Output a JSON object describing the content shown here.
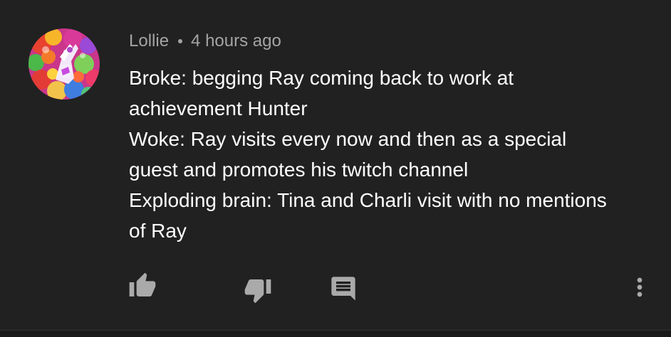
{
  "comment": {
    "author": "Lollie",
    "separator": "•",
    "timestamp": "4 hours ago",
    "lines": [
      "Broke: begging Ray coming back to work at",
      "achievement Hunter",
      "Woke: Ray visits every now and then as a special",
      "guest and promotes his twitch channel",
      "Exploding brain: Tina and Charli visit with no mentions",
      "of Ray"
    ]
  },
  "actions": {
    "like_icon": "thumbs-up-icon",
    "dislike_icon": "thumbs-down-icon",
    "reply_icon": "comment-icon",
    "more_icon": "more-vertical-icon"
  },
  "colors": {
    "background": "#212121",
    "text_primary": "#ffffff",
    "text_secondary": "#a4a4a4",
    "icon": "#aaaaaa"
  }
}
